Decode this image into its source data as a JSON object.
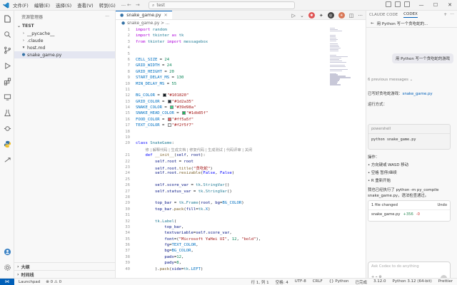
{
  "menu": [
    "文件(F)",
    "编辑(E)",
    "选择(S)",
    "查看(V)",
    "转到(G)",
    "..."
  ],
  "command_center": "test",
  "sidebar": {
    "title": "资源管理器",
    "section": "TEST",
    "tree": [
      {
        "label": "__pycache__",
        "icon": "chevron-right",
        "indent": 1
      },
      {
        "label": ".claude",
        "icon": "chevron-right",
        "indent": 1
      },
      {
        "label": "host.md",
        "icon": "markdown-icon",
        "indent": 1
      },
      {
        "label": "snake_game.py",
        "icon": "python-icon",
        "indent": 1
      }
    ],
    "bottom_sections": [
      "大纲",
      "时间线"
    ]
  },
  "editor": {
    "tab": "snake_game.py",
    "breadcrumb": "snake_game.py > ...",
    "codelens": "修 | 解释代码 | 生成文档 | 修复代码 | 生成测试 | 代码评审 | 关闭",
    "lines": [
      {
        "n": "1",
        "html": "<span class='k'>import</span> <span class='c'>random</span>"
      },
      {
        "n": "2",
        "html": "<span class='k'>import</span> <span class='c'>tkinter</span> <span class='k'>as</span> <span class='c'>tk</span>"
      },
      {
        "n": "3",
        "html": "<span class='k'>from</span> <span class='c'>tkinter</span> <span class='k'>import</span> <span class='c'>messagebox</span>"
      },
      {
        "n": "4",
        "html": ""
      },
      {
        "n": "5",
        "html": ""
      },
      {
        "n": "6",
        "html": "<span class='cst'>CELL_SIZE</span> = <span class='n'>24</span>"
      },
      {
        "n": "7",
        "html": "<span class='cst'>GRID_WIDTH</span> = <span class='n'>24</span>"
      },
      {
        "n": "8",
        "html": "<span class='cst'>GRID_HEIGHT</span> = <span class='n'>20</span>"
      },
      {
        "n": "9",
        "html": "<span class='cst'>START_DELAY_MS</span> = <span class='n'>130</span>"
      },
      {
        "n": "10",
        "html": "<span class='cst'>MIN_DELAY_MS</span> = <span class='n'>55</span>"
      },
      {
        "n": "11",
        "html": ""
      },
      {
        "n": "12",
        "html": "<span class='cst'>BG_COLOR</span> = <span class='sw' style='background:#101820'></span><span class='s'>\"#101820\"</span>"
      },
      {
        "n": "13",
        "html": "<span class='cst'>GRID_COLOR</span> = <span class='sw' style='background:#1d2a35'></span><span class='s'>\"#1d2a35\"</span>"
      },
      {
        "n": "14",
        "html": "<span class='cst'>SNAKE_COLOR</span> = <span class='sw' style='background:#39d98a'></span><span class='s'>\"#39d98a\"</span>"
      },
      {
        "n": "15",
        "html": "<span class='cst'>SNAKE_HEAD_COLOR</span> = <span class='sw' style='background:#1db85f'></span><span class='s'>\"#1db85f\"</span>"
      },
      {
        "n": "16",
        "html": "<span class='cst'>FOOD_COLOR</span> = <span class='sw' style='background:#ff5a5f'></span><span class='s'>\"#ff5a5f\"</span>"
      },
      {
        "n": "17",
        "html": "<span class='cst'>TEXT_COLOR</span> = <span class='sw' style='background:#f2f5f7'></span><span class='s'>\"#f2f5f7\"</span>"
      },
      {
        "n": "18",
        "html": ""
      },
      {
        "n": "19",
        "html": ""
      },
      {
        "n": "20",
        "html": "<span class='kb'>class</span> <span class='c'>SnakeGame</span>:"
      },
      {
        "n": "",
        "html": "    <span class='codelens'>修 | 解释代码 | 生成文档 | 修复代码 | 生成测试 | 代码评审 | 关闭</span>"
      },
      {
        "n": "21",
        "html": "    <span class='kb'>def</span> <span class='f'>__init__</span>(<span class='v'>self</span>, <span class='v'>root</span>):"
      },
      {
        "n": "22",
        "html": "        <span class='v'>self</span>.<span class='v'>root</span> = <span class='v'>root</span>"
      },
      {
        "n": "23",
        "html": "        <span class='v'>self</span>.<span class='v'>root</span>.<span class='f'>title</span>(<span class='s'>\"贪吃蛇\"</span>)"
      },
      {
        "n": "24",
        "html": "        <span class='v'>self</span>.<span class='v'>root</span>.<span class='f'>resizable</span>(<span class='kb'>False</span>, <span class='kb'>False</span>)"
      },
      {
        "n": "25",
        "html": ""
      },
      {
        "n": "26",
        "html": "        <span class='v'>self</span>.<span class='v'>score_var</span> = <span class='c'>tk</span>.<span class='c'>StringVar</span>()"
      },
      {
        "n": "27",
        "html": "        <span class='v'>self</span>.<span class='v'>status_var</span> = <span class='c'>tk</span>.<span class='c'>StringVar</span>()"
      },
      {
        "n": "28",
        "html": ""
      },
      {
        "n": "29",
        "html": "        <span class='v'>top_bar</span> = <span class='c'>tk</span>.<span class='c'>Frame</span>(<span class='v'>root</span>, <span class='v'>bg</span>=<span class='cst'>BG_COLOR</span>)"
      },
      {
        "n": "30",
        "html": "        <span class='v'>top_bar</span>.<span class='f'>pack</span>(<span class='v'>fill</span>=<span class='c'>tk</span>.<span class='cst'>X</span>)"
      },
      {
        "n": "31",
        "html": ""
      },
      {
        "n": "32",
        "html": "        <span class='c'>tk</span>.<span class='c'>Label</span>("
      },
      {
        "n": "33",
        "html": "            <span class='v'>top_bar</span>,"
      },
      {
        "n": "34",
        "html": "            <span class='v'>textvariable</span>=<span class='v'>self</span>.<span class='v'>score_var</span>,"
      },
      {
        "n": "35",
        "html": "            <span class='v'>font</span>=(<span class='s'>\"Microsoft YaHei UI\"</span>, <span class='n'>12</span>, <span class='s'>\"bold\"</span>),"
      },
      {
        "n": "36",
        "html": "            <span class='v'>fg</span>=<span class='cst'>TEXT_COLOR</span>,"
      },
      {
        "n": "37",
        "html": "            <span class='v'>bg</span>=<span class='cst'>BG_COLOR</span>,"
      },
      {
        "n": "38",
        "html": "            <span class='v'>padx</span>=<span class='n'>12</span>,"
      },
      {
        "n": "39",
        "html": "            <span class='v'>pady</span>=<span class='n'>8</span>,"
      },
      {
        "n": "40",
        "html": "        ).<span class='f'>pack</span>(<span class='v'>side</span>=<span class='c'>tk</span>.<span class='cst'>LEFT</span>)"
      }
    ]
  },
  "aux": {
    "tabs": [
      "CLAUDE CODE",
      "CODEX"
    ],
    "active_tab": "CODEX",
    "history_title": "用 Python 写一个贪吃蛇的...",
    "user_message": "用 Python 写一个贪吃蛇的游戏",
    "previous_messages": "6 previous messages",
    "done_prefix": "已写好贪吃蛇游戏：",
    "done_file": "snake_game.py",
    "run_label": "运行方式：",
    "code_lang": "powershell",
    "code_cmd": "python snake_game.py",
    "ops_label": "操作：",
    "ops": [
      "方向键或 WASD 移动",
      "空格 暂停/继续",
      "R 重新开始"
    ],
    "compile_note": "我也已经执行了 python -m py_compile snake_game.py，语法检查通过。",
    "changes_header": "1 file changed",
    "undo_label": "Undo",
    "changed_file": "snake_game.py",
    "added": "+356",
    "removed": "-0",
    "input_placeholder": "Ask Codex to do anything"
  },
  "status": {
    "left": [
      "Launchpad",
      "⊗ 0 ⚠ 0"
    ],
    "right": [
      "行 1, 列 1",
      "空格: 4",
      "UTF-8",
      "CRLF",
      "{} Python",
      "已完成",
      "3.12.0",
      "Python 3.12 (64-bit)",
      "Prettier"
    ]
  }
}
